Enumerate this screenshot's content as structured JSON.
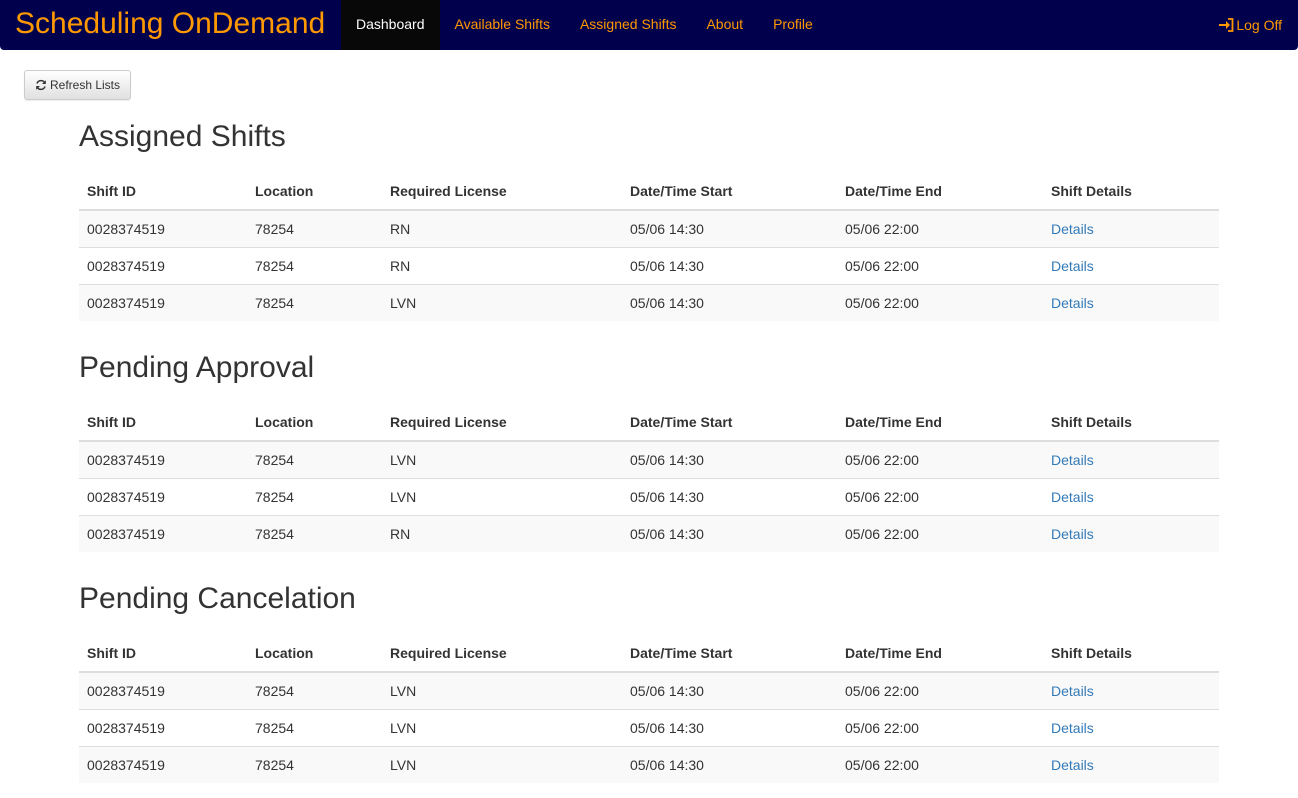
{
  "navbar": {
    "brand": "Scheduling OnDemand",
    "items": [
      {
        "label": "Dashboard",
        "active": true
      },
      {
        "label": "Available Shifts"
      },
      {
        "label": "Assigned Shifts"
      },
      {
        "label": "About"
      },
      {
        "label": "Profile"
      }
    ],
    "logoff": "Log Off"
  },
  "toolbar": {
    "refresh_label": "Refresh Lists"
  },
  "columns": [
    "Shift ID",
    "Location",
    "Required License",
    "Date/Time Start",
    "Date/Time End",
    "Shift Details"
  ],
  "sections": [
    {
      "title": "Assigned Shifts",
      "rows": [
        {
          "id": "0028374519",
          "location": "78254",
          "license": "RN",
          "start": "05/06 14:30",
          "end": "05/06 22:00",
          "details": "Details"
        },
        {
          "id": "0028374519",
          "location": "78254",
          "license": "RN",
          "start": "05/06 14:30",
          "end": "05/06 22:00",
          "details": "Details"
        },
        {
          "id": "0028374519",
          "location": "78254",
          "license": "LVN",
          "start": "05/06 14:30",
          "end": "05/06 22:00",
          "details": "Details"
        }
      ]
    },
    {
      "title": "Pending Approval",
      "rows": [
        {
          "id": "0028374519",
          "location": "78254",
          "license": "LVN",
          "start": "05/06 14:30",
          "end": "05/06 22:00",
          "details": "Details"
        },
        {
          "id": "0028374519",
          "location": "78254",
          "license": "LVN",
          "start": "05/06 14:30",
          "end": "05/06 22:00",
          "details": "Details"
        },
        {
          "id": "0028374519",
          "location": "78254",
          "license": "RN",
          "start": "05/06 14:30",
          "end": "05/06 22:00",
          "details": "Details"
        }
      ]
    },
    {
      "title": "Pending Cancelation",
      "rows": [
        {
          "id": "0028374519",
          "location": "78254",
          "license": "LVN",
          "start": "05/06 14:30",
          "end": "05/06 22:00",
          "details": "Details"
        },
        {
          "id": "0028374519",
          "location": "78254",
          "license": "LVN",
          "start": "05/06 14:30",
          "end": "05/06 22:00",
          "details": "Details"
        },
        {
          "id": "0028374519",
          "location": "78254",
          "license": "LVN",
          "start": "05/06 14:30",
          "end": "05/06 22:00",
          "details": "Details"
        }
      ]
    }
  ],
  "colors": {
    "navbar_bg": "#00004d",
    "accent": "#ff9900",
    "link": "#337ab7"
  }
}
